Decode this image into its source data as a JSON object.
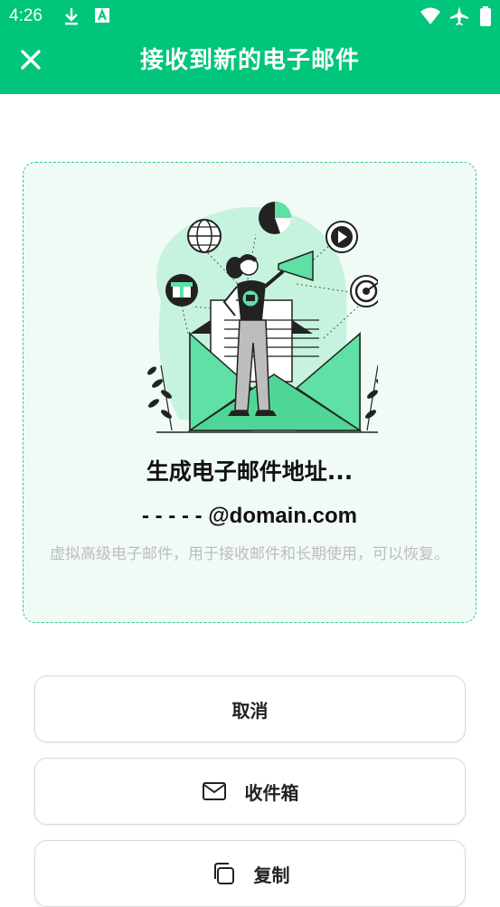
{
  "status_bar": {
    "time": "4:26"
  },
  "header": {
    "title": "接收到新的电子邮件"
  },
  "card": {
    "title": "生成电子邮件地址...",
    "email": "- - - - - @domain.com",
    "description": "虚拟高级电子邮件，用于接收邮件和长期使用，可以恢复。"
  },
  "buttons": {
    "cancel": "取消",
    "inbox": "收件箱",
    "copy": "复制"
  },
  "colors": {
    "brand": "#00c57a",
    "accent_light": "#5fe0a4",
    "card_bg": "#f1fbf6"
  },
  "icons": [
    "close-icon",
    "download-icon",
    "a-icon",
    "wifi-icon",
    "airplane-icon",
    "battery-icon",
    "mail-icon",
    "copy-icon"
  ]
}
